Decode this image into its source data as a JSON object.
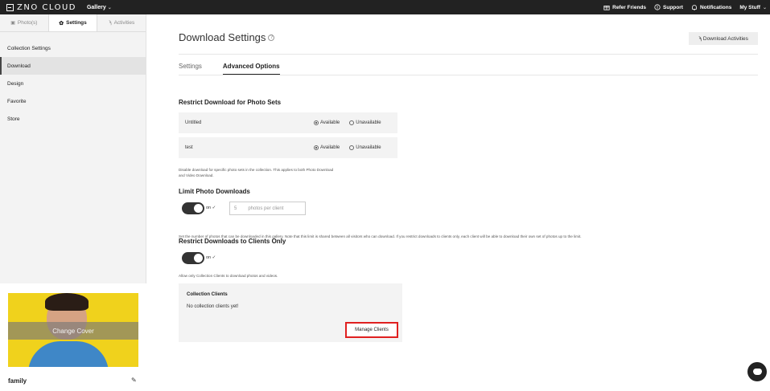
{
  "topbar": {
    "logo_text": "ZNO CLOUD",
    "gallery_menu": "Gallery",
    "items": [
      {
        "label": "Refer Friends",
        "icon": "gift-icon"
      },
      {
        "label": "Support",
        "icon": "info-circle-icon"
      },
      {
        "label": "Notifications",
        "icon": "bell-icon"
      },
      {
        "label": "My Stuff",
        "icon": "chevron-down-icon"
      }
    ]
  },
  "sidebar": {
    "tabs": [
      {
        "label": "Photo(s)",
        "icon": "image-icon",
        "active": false
      },
      {
        "label": "Settings",
        "icon": "gear-icon",
        "active": true
      },
      {
        "label": "Activities",
        "icon": "activity-icon",
        "active": false
      }
    ],
    "nav": [
      {
        "label": "Collection Settings",
        "active": false
      },
      {
        "label": "Download",
        "active": true
      },
      {
        "label": "Design",
        "active": false
      },
      {
        "label": "Favorite",
        "active": false
      },
      {
        "label": "Store",
        "active": false
      }
    ],
    "cover_button": "Change Cover",
    "collection_name": "family"
  },
  "main": {
    "title": "Download Settings",
    "activities_button": "Download Activities",
    "tabs": [
      {
        "label": "Settings",
        "active": false
      },
      {
        "label": "Advanced Options",
        "active": true
      }
    ],
    "restrict_sets": {
      "title": "Restrict Download for Photo Sets",
      "rows": [
        {
          "name": "Untitled",
          "available": "Available",
          "unavailable": "Unavailable",
          "selected": "available"
        },
        {
          "name": "test",
          "available": "Available",
          "unavailable": "Unavailable",
          "selected": "available"
        }
      ],
      "note_line1": "Disable download for specific photo sets in the collection. This applies to both Photo Download",
      "note_line2": "and Video Download."
    },
    "limit": {
      "title": "Limit Photo Downloads",
      "toggle_label": "on",
      "input_value": "5",
      "input_placeholder": "photos per client",
      "note": "Set the number of photos that can be downloaded in this gallery. Note that this limit is shared between all visitors who can download. If you restrict downloads to clients only, each client will be able to download their own set of photos up to the limit."
    },
    "clients_only": {
      "title": "Restrict Downloads to Clients Only",
      "toggle_label": "on",
      "note": "Allow only Collection Clients to download photos and videos.",
      "box_title": "Collection Clients",
      "empty_text": "No collection clients yet!",
      "manage_button": "Manage Clients"
    }
  },
  "colors": {
    "topbar": "#222222",
    "sidebar_bg": "#f3f3f3",
    "highlight_box": "#e02020",
    "cover_bg": "#f0d21c"
  }
}
